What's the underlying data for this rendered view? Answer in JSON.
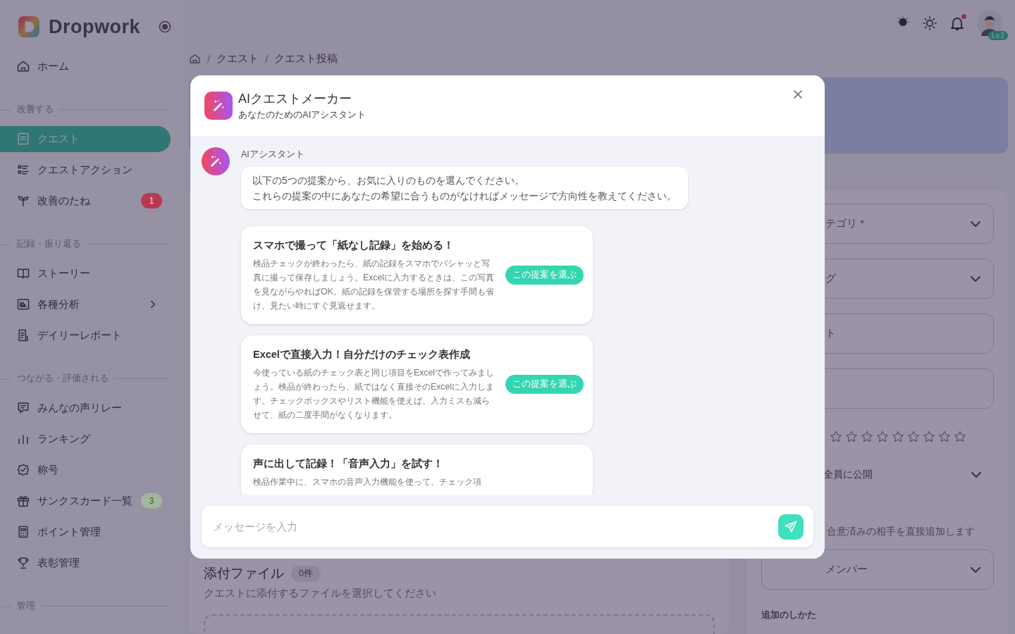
{
  "sidebar": {
    "logo": "Dropwork",
    "sections": [
      {
        "items": [
          {
            "label": "ホーム",
            "kind": "link",
            "selected": false
          }
        ]
      },
      {
        "title": "改善する",
        "items": [
          {
            "label": "クエスト",
            "kind": "link",
            "selected": true
          },
          {
            "label": "クエストアクション",
            "kind": "link",
            "selected": false
          },
          {
            "label": "改善のたね",
            "kind": "link",
            "selected": false,
            "badge": "1",
            "color": "#b93a50"
          }
        ]
      },
      {
        "title": "記録・振り返る",
        "items": [
          {
            "label": "ストーリー",
            "kind": "link",
            "selected": false
          },
          {
            "label": "各種分析",
            "kind": "group",
            "selected": false
          },
          {
            "label": "デイリーレポート",
            "kind": "link",
            "selected": false
          }
        ]
      },
      {
        "title": "つながる・評価される",
        "items": [
          {
            "label": "みんなの声リレー",
            "kind": "link",
            "selected": false
          },
          {
            "label": "ランキング",
            "kind": "link",
            "selected": false
          },
          {
            "label": "称号",
            "kind": "link",
            "selected": false
          },
          {
            "label": "サンクスカード一覧",
            "kind": "link",
            "selected": false,
            "badge": "3",
            "color": "#a3b59c"
          },
          {
            "label": "ポイント管理",
            "kind": "link",
            "selected": false
          },
          {
            "label": "表彰管理",
            "kind": "link",
            "selected": false
          }
        ]
      },
      {
        "title": "管理"
      }
    ]
  },
  "header": {
    "notification_unread": true,
    "level": "Lv.2"
  },
  "breadcrumb": [
    {
      "separator": "/",
      "label": "クエスト"
    },
    {
      "separator": "/",
      "label": "クエスト投稿"
    }
  ],
  "form": {
    "fields": [
      {
        "kind": "select",
        "value": "テゴリ *"
      },
      {
        "kind": "select",
        "value": "グ"
      },
      {
        "kind": "text",
        "value": "ト"
      },
      {
        "kind": "text"
      },
      {
        "kind": "stars",
        "stars": 0
      },
      {
        "kind": "plain-select",
        "value": "全員に公開"
      },
      {
        "kind": "note",
        "value": "合意済みの相手を直接追加します"
      },
      {
        "kind": "select",
        "value": "メンバー"
      },
      {
        "kind": "label",
        "value": "追加のしかた"
      }
    ]
  },
  "attachments": {
    "title": "添付ファイル",
    "count": "0件",
    "hint": "クエストに添付するファイルを選択してください"
  },
  "modal": {
    "title": "AIクエストメーカー",
    "subtitle": "あなたのためのAIアシスタント",
    "message": {
      "sender": "AIアシスタント",
      "lines": [
        "以下の5つの提案から、お気に入りのものを選んでください。",
        "これらの提案の中にあなたの希望に合うものがなければメッセージで方向性を教えてください。"
      ]
    },
    "suggestions": [
      {
        "title": "スマホで撮って「紙なし記録」を始める！",
        "body": "検品チェックが終わったら、紙の記録をスマホでパシャッと写真に撮って保存しましょう。Excelに入力するときは、この写真を見ながらやればOK。紙の記録を保管する場所を探す手間も省け、見たい時にすぐ見返せます。",
        "button": "この提案を選ぶ"
      },
      {
        "title": "Excelで直接入力！自分だけのチェック表作成",
        "body": "今使っている紙のチェック表と同じ項目をExcelで作ってみましょう。検品が終わったら、紙ではなく直接そのExcelに入力します。チェックボックスやリスト機能を使えば、入力ミスも減らせて、紙の二度手間がなくなります。",
        "button": "この提案を選ぶ"
      },
      {
        "title": "声に出して記録！「音声入力」を試す！",
        "body": "検品作業中に、スマホの音声入力機能を使って、チェック項"
      }
    ],
    "input": {
      "placeholder": "メッセージを入力"
    }
  }
}
